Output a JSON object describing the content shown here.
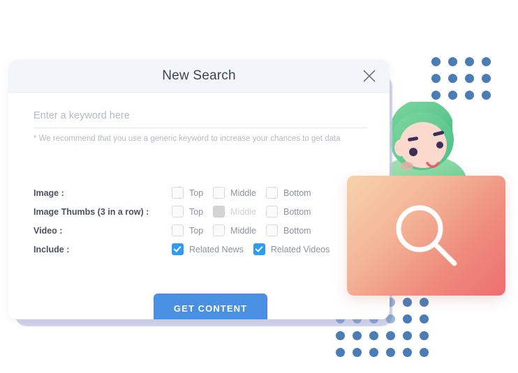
{
  "dialog": {
    "title": "New Search",
    "close_icon": "close-icon",
    "search": {
      "value": "",
      "placeholder": "Enter a keyword here",
      "helper_text": "* We recommend that you use a generic keyword to increase your chances to get data"
    },
    "option_rows": [
      {
        "label": "Image :",
        "choices": [
          {
            "label": "Top",
            "checked": false,
            "disabled": false
          },
          {
            "label": "Middle",
            "checked": false,
            "disabled": false
          },
          {
            "label": "Bottom",
            "checked": false,
            "disabled": false
          }
        ]
      },
      {
        "label": "Image Thumbs (3 in a row) :",
        "choices": [
          {
            "label": "Top",
            "checked": false,
            "disabled": false
          },
          {
            "label": "Middle",
            "checked": false,
            "disabled": true
          },
          {
            "label": "Bottom",
            "checked": false,
            "disabled": false
          }
        ]
      },
      {
        "label": "Video :",
        "choices": [
          {
            "label": "Top",
            "checked": false,
            "disabled": false
          },
          {
            "label": "Middle",
            "checked": false,
            "disabled": false
          },
          {
            "label": "Bottom",
            "checked": false,
            "disabled": false
          }
        ]
      },
      {
        "label": "Include :",
        "choices": [
          {
            "label": "Related News",
            "checked": true,
            "disabled": false
          },
          {
            "label": "Related Videos",
            "checked": true,
            "disabled": false
          }
        ]
      }
    ],
    "submit_label": "GET CONTENT"
  },
  "decoration": {
    "gradient_card": {
      "icon": "search-icon",
      "gradient_from": "#f7d3ab",
      "gradient_to": "#ee6f70"
    },
    "dot_color": "#4a7cb5",
    "character_icon": "character-avatar",
    "back_card_color": "#c7cbe4"
  },
  "colors": {
    "accent": "#4a90e2",
    "checkbox_checked": "#2f9cf4",
    "header_bg": "#f2f5fa",
    "title_text": "#3d4454"
  }
}
